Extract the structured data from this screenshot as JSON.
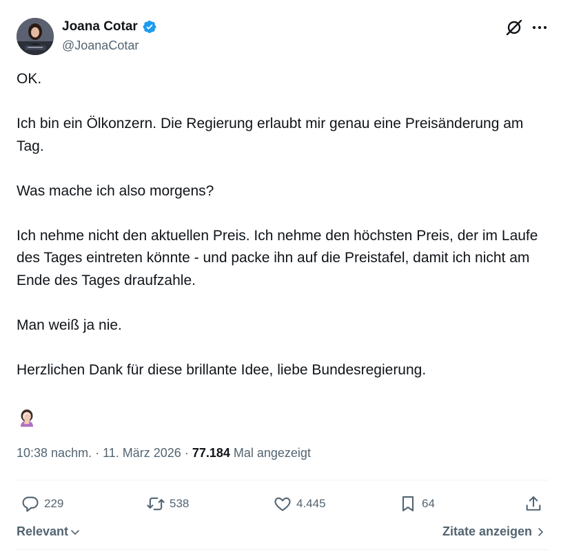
{
  "author": {
    "name": "Joana Cotar",
    "handle": "@JoanaCotar",
    "verified": true
  },
  "tweet": {
    "paragraphs": [
      "OK.",
      "Ich bin ein Ölkonzern. Die Regierung erlaubt mir genau eine Preisänderung am Tag.",
      "Was mache ich also morgens?",
      "Ich nehme nicht den aktuellen Preis. Ich nehme den höchsten Preis, der im Laufe des Tages eintreten könnte - und packe ihn auf die Preistafel, damit ich nicht am Ende des Tages draufzahle.",
      "Man weiß ja nie.",
      "Herzlichen Dank für diese brillante Idee, liebe Bundesregierung."
    ],
    "emoji": "🤦🏻‍♀️"
  },
  "meta": {
    "time": "10:38 nachm.",
    "separator": " · ",
    "date": "11. März 2026",
    "views_count": "77.184",
    "views_label": " Mal angezeigt"
  },
  "actions": {
    "replies": "229",
    "reposts": "538",
    "likes": "4.445",
    "bookmarks": "64"
  },
  "footer": {
    "sort_label": "Relevant",
    "quotes_label": "Zitate anzeigen"
  },
  "colors": {
    "text": "#0f1419",
    "secondary": "#536471",
    "verified": "#1d9bf0",
    "divider": "#eff3f4"
  },
  "icons": [
    "grok-icon",
    "more-icon",
    "reply-icon",
    "repost-icon",
    "like-icon",
    "bookmark-icon",
    "share-icon",
    "verified-badge-icon",
    "chevron-down-icon",
    "chevron-right-icon"
  ]
}
